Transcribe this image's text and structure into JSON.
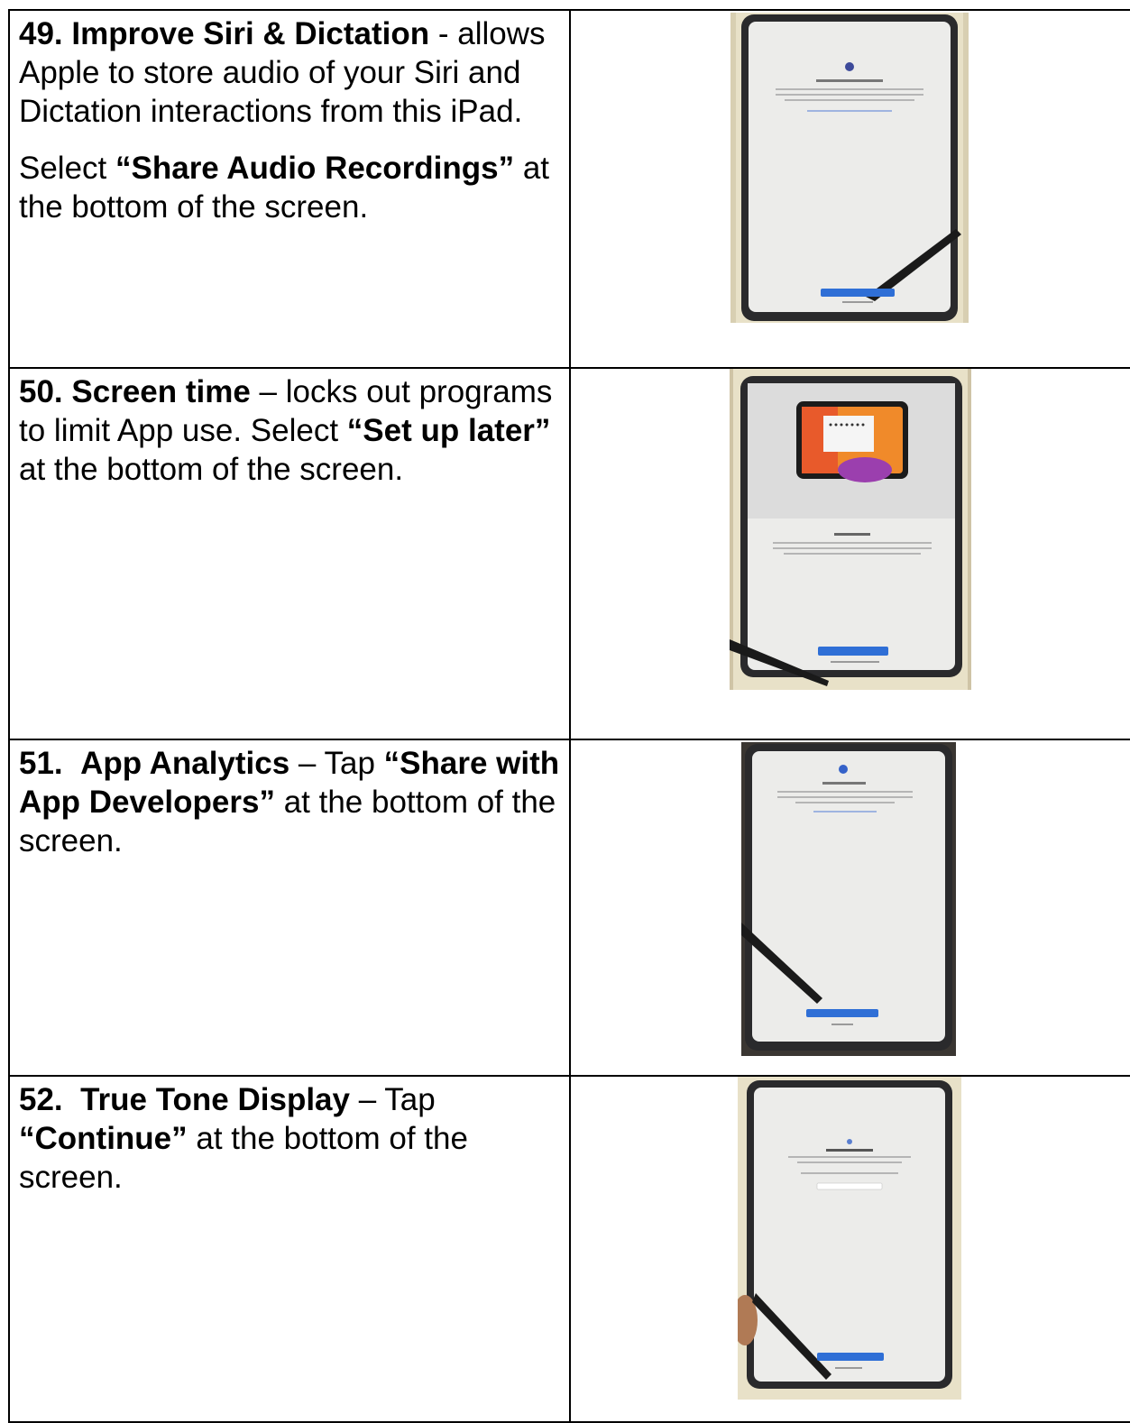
{
  "rows": [
    {
      "number": "49.",
      "title": "Improve Siri & Dictation",
      "separator": " -",
      "description": "allows Apple to store audio of your Siri and Dictation interactions from this iPad.",
      "instruction_prefix": "Select ",
      "instruction_target": "“Share Audio Recordings”",
      "instruction_suffix": " at the bottom of the screen.",
      "photo_icon": "ipad-siri-dictation-setup-photo"
    },
    {
      "number": "50.",
      "title": "Screen time",
      "separator": " – ",
      "description": "locks out programs to limit App use.  Select ",
      "instruction_target": "“Set up later”",
      "instruction_suffix": " at the bottom of the screen.",
      "photo_icon": "ipad-screen-time-setup-photo"
    },
    {
      "number": "51.",
      "title": "App Analytics",
      "separator": " – ",
      "instruction_prefix": "Tap ",
      "instruction_target": "“Share with App Developers”",
      "instruction_suffix": " at the bottom of the screen.",
      "photo_icon": "ipad-app-analytics-setup-photo"
    },
    {
      "number": "52.",
      "title": "True Tone Display",
      "separator": " – ",
      "instruction_prefix": "Tap ",
      "instruction_target": "“Continue”",
      "instruction_suffix": " at the bottom of the screen.",
      "photo_icon": "ipad-true-tone-setup-photo"
    }
  ],
  "colors": {
    "setup_button": "#2f6fd6",
    "ipad_bezel": "#2a2a2c",
    "ipad_screen": "#ececea",
    "box_liner": "#e8e1c8"
  }
}
